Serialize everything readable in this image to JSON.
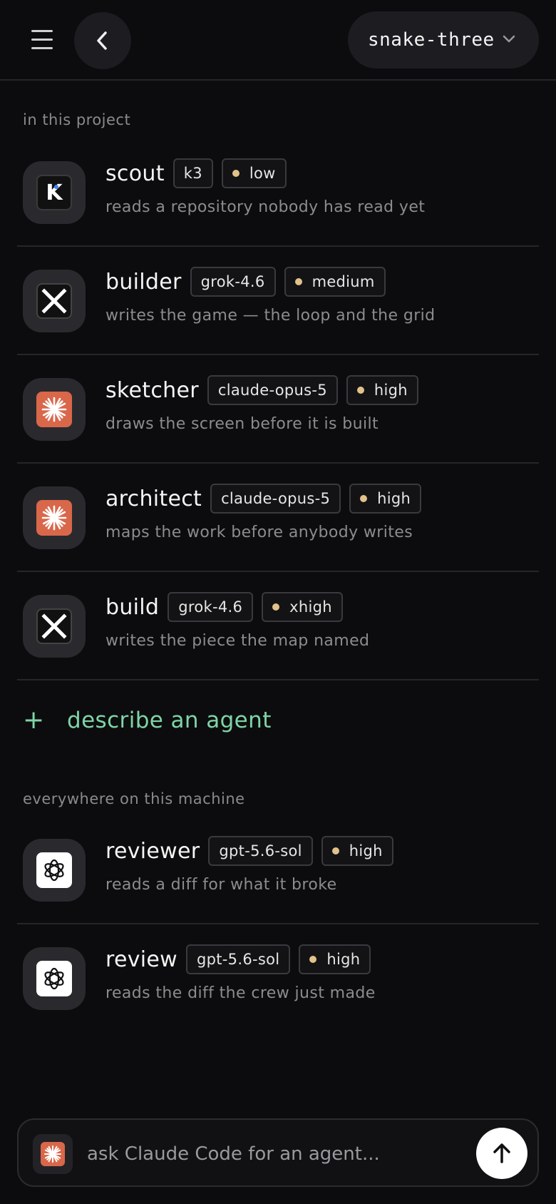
{
  "header": {
    "project_name": "snake-three"
  },
  "sections": {
    "project_label": "in this project",
    "machine_label": "everywhere on this machine"
  },
  "project_agents": [
    {
      "name": "scout",
      "model": "k3",
      "effort": "low",
      "description": "reads a repository nobody has read yet",
      "icon": "kimi-icon"
    },
    {
      "name": "builder",
      "model": "grok-4.6",
      "effort": "medium",
      "description": "writes the game — the loop and the grid",
      "icon": "grok-icon"
    },
    {
      "name": "sketcher",
      "model": "claude-opus-5",
      "effort": "high",
      "description": "draws the screen before it is built",
      "icon": "claude-icon"
    },
    {
      "name": "architect",
      "model": "claude-opus-5",
      "effort": "high",
      "description": "maps the work before anybody writes",
      "icon": "claude-icon"
    },
    {
      "name": "build",
      "model": "grok-4.6",
      "effort": "xhigh",
      "description": "writes the piece the map named",
      "icon": "grok-icon"
    }
  ],
  "add_agent": {
    "plus": "+",
    "label": "describe an agent"
  },
  "machine_agents": [
    {
      "name": "reviewer",
      "model": "gpt-5.6-sol",
      "effort": "high",
      "description": "reads a diff for what it broke",
      "icon": "openai-icon"
    },
    {
      "name": "review",
      "model": "gpt-5.6-sol",
      "effort": "high",
      "description": "reads the diff the crew just made",
      "icon": "openai-icon"
    }
  ],
  "composer": {
    "placeholder": "ask Claude Code for an agent..."
  },
  "colors": {
    "background": "#0c0c0e",
    "accent_green": "#7fd4a6",
    "effort_dot": "#e2c28a",
    "claude_orange": "#d9674a"
  }
}
